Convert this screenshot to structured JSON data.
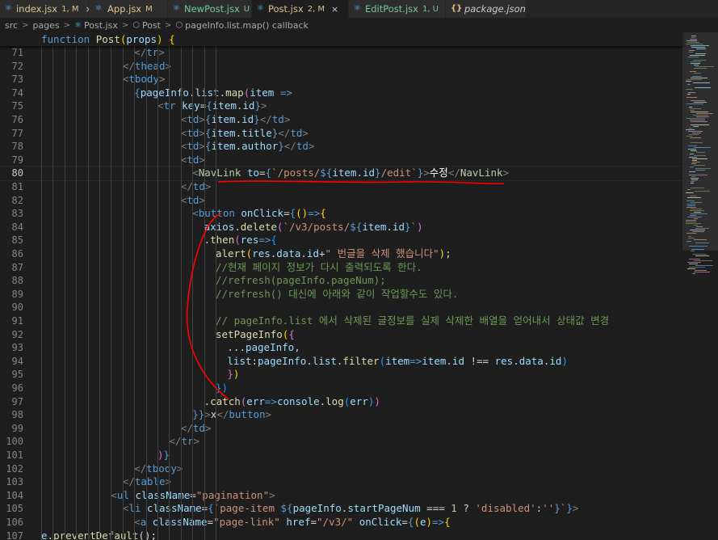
{
  "tabs": [
    {
      "name": "index.jsx",
      "badge": "1, M",
      "state": "mod",
      "icon": "react-icon",
      "close": "×"
    },
    {
      "name": "App.jsx",
      "badge": "M",
      "state": "mod",
      "icon": "react-icon"
    },
    {
      "name": "NewPost.jsx",
      "badge": "U",
      "state": "unt",
      "icon": "react-icon"
    },
    {
      "name": "Post.jsx",
      "badge": "2, M",
      "state": "mod",
      "icon": "react-icon",
      "close": "×"
    },
    {
      "name": "EditPost.jsx",
      "badge": "1, U",
      "state": "unt",
      "icon": "react-icon"
    },
    {
      "name": "package.json",
      "badge": "",
      "state": "plain",
      "icon": "json-icon"
    }
  ],
  "breadcrumb": {
    "parts": [
      "src",
      "pages",
      "Post.jsx",
      "Post",
      "pageInfo.list.map() callback"
    ],
    "separator": ">"
  },
  "sticky": {
    "text": "function Post(props) {"
  },
  "colors": {
    "background": "#1e1e1e",
    "keyword": "#569cd6",
    "string": "#ce9178",
    "variable": "#9cdcfe",
    "comment": "#6a9955",
    "annotation": "#ff0000"
  },
  "lines": [
    {
      "num": "71",
      "tokens": [
        [
          "</",
          "g"
        ],
        [
          "tr",
          "t"
        ],
        [
          ">",
          "g"
        ]
      ]
    },
    {
      "num": "72",
      "tokens": [
        [
          "</",
          "g"
        ],
        [
          "thead",
          "t"
        ],
        [
          ">",
          "g"
        ]
      ]
    },
    {
      "num": "73",
      "tokens": [
        [
          "<",
          "g"
        ],
        [
          "tbody",
          "t"
        ],
        [
          ">",
          "g"
        ]
      ]
    },
    {
      "num": "74",
      "tokens": [
        [
          "{",
          "k"
        ],
        [
          "pageInfo",
          "v"
        ],
        [
          ".",
          "w"
        ],
        [
          "list",
          "v"
        ],
        [
          ".",
          "w"
        ],
        [
          "map",
          "f"
        ],
        [
          "(",
          "p"
        ],
        [
          "item",
          "v"
        ],
        [
          " =>",
          "k"
        ]
      ]
    },
    {
      "num": "75",
      "tokens": [
        [
          "<",
          "g"
        ],
        [
          "tr",
          "t"
        ],
        [
          " ",
          "w"
        ],
        [
          "key",
          "v"
        ],
        [
          "=",
          "w"
        ],
        [
          "{",
          "k"
        ],
        [
          "item",
          "v"
        ],
        [
          ".",
          "w"
        ],
        [
          "id",
          "v"
        ],
        [
          "}",
          "k"
        ],
        [
          ">",
          "g"
        ]
      ]
    },
    {
      "num": "76",
      "tokens": [
        [
          "<",
          "g"
        ],
        [
          "td",
          "t"
        ],
        [
          ">",
          "g"
        ],
        [
          "{",
          "k"
        ],
        [
          "item",
          "v"
        ],
        [
          ".",
          "w"
        ],
        [
          "id",
          "v"
        ],
        [
          "}",
          "k"
        ],
        [
          "</",
          "g"
        ],
        [
          "td",
          "t"
        ],
        [
          ">",
          "g"
        ]
      ]
    },
    {
      "num": "77",
      "tokens": [
        [
          "<",
          "g"
        ],
        [
          "td",
          "t"
        ],
        [
          ">",
          "g"
        ],
        [
          "{",
          "k"
        ],
        [
          "item",
          "v"
        ],
        [
          ".",
          "w"
        ],
        [
          "title",
          "v"
        ],
        [
          "}",
          "k"
        ],
        [
          "</",
          "g"
        ],
        [
          "td",
          "t"
        ],
        [
          ">",
          "g"
        ]
      ]
    },
    {
      "num": "78",
      "tokens": [
        [
          "<",
          "g"
        ],
        [
          "td",
          "t"
        ],
        [
          ">",
          "g"
        ],
        [
          "{",
          "k"
        ],
        [
          "item",
          "v"
        ],
        [
          ".",
          "w"
        ],
        [
          "author",
          "v"
        ],
        [
          "}",
          "k"
        ],
        [
          "</",
          "g"
        ],
        [
          "td",
          "t"
        ],
        [
          ">",
          "g"
        ]
      ]
    },
    {
      "num": "79",
      "tokens": [
        [
          "<",
          "g"
        ],
        [
          "td",
          "t"
        ],
        [
          ">",
          "g"
        ]
      ]
    },
    {
      "num": "80",
      "tokens": [
        [
          "<",
          "g"
        ],
        [
          "NavLink",
          "n"
        ],
        [
          " ",
          "w"
        ],
        [
          "to",
          "v"
        ],
        [
          "=",
          "w"
        ],
        [
          "{",
          "k"
        ],
        [
          "`/posts/",
          "s"
        ],
        [
          "${",
          "k"
        ],
        [
          "item",
          "v"
        ],
        [
          ".",
          "w"
        ],
        [
          "id",
          "v"
        ],
        [
          "}",
          "k"
        ],
        [
          "/edit`",
          "s"
        ],
        [
          "}",
          "k"
        ],
        [
          ">",
          "g"
        ],
        [
          "수정",
          "ko"
        ],
        [
          "</",
          "g"
        ],
        [
          "NavLink",
          "n"
        ],
        [
          ">",
          "g"
        ]
      ]
    },
    {
      "num": "81",
      "tokens": [
        [
          "</",
          "g"
        ],
        [
          "td",
          "t"
        ],
        [
          ">",
          "g"
        ]
      ]
    },
    {
      "num": "82",
      "tokens": [
        [
          "<",
          "g"
        ],
        [
          "td",
          "t"
        ],
        [
          ">",
          "g"
        ]
      ]
    },
    {
      "num": "83",
      "tokens": [
        [
          "<",
          "g"
        ],
        [
          "button",
          "t"
        ],
        [
          " ",
          "w"
        ],
        [
          "onClick",
          "v"
        ],
        [
          "=",
          "w"
        ],
        [
          "{",
          "k"
        ],
        [
          "()",
          "y"
        ],
        [
          "=>",
          "k"
        ],
        [
          "{",
          "y"
        ]
      ]
    },
    {
      "num": "84",
      "tokens": [
        [
          "axios",
          "v"
        ],
        [
          ".",
          "w"
        ],
        [
          "delete",
          "f"
        ],
        [
          "(",
          "p"
        ],
        [
          "`/v3/posts/",
          "s"
        ],
        [
          "${",
          "k"
        ],
        [
          "item",
          "v"
        ],
        [
          ".",
          "w"
        ],
        [
          "id",
          "v"
        ],
        [
          "}",
          "k"
        ],
        [
          "`",
          "s"
        ],
        [
          ")",
          "p"
        ]
      ]
    },
    {
      "num": "85",
      "tokens": [
        [
          ".",
          "w"
        ],
        [
          "then",
          "f"
        ],
        [
          "(",
          "p"
        ],
        [
          "res",
          "v"
        ],
        [
          "=>",
          "k"
        ],
        [
          "{",
          "b"
        ]
      ]
    },
    {
      "num": "86",
      "tokens": [
        [
          "alert",
          "f"
        ],
        [
          "(",
          "y"
        ],
        [
          "res",
          "v"
        ],
        [
          ".",
          "w"
        ],
        [
          "data",
          "v"
        ],
        [
          ".",
          "w"
        ],
        [
          "id",
          "v"
        ],
        [
          "+",
          "w"
        ],
        [
          "\" 번글을 삭제 했습니다\"",
          "s"
        ],
        [
          ")",
          "y"
        ],
        [
          ";",
          "w"
        ]
      ]
    },
    {
      "num": "87",
      "tokens": [
        [
          "//현재 페이지 정보가 다시 출력되도록 한다.",
          "cm"
        ]
      ]
    },
    {
      "num": "88",
      "tokens": [
        [
          "//refresh(pageInfo.pageNum);",
          "cm"
        ]
      ]
    },
    {
      "num": "89",
      "tokens": [
        [
          "//refresh() 대신에 아래와 같이 작업할수도 있다.",
          "cm"
        ]
      ]
    },
    {
      "num": "90",
      "tokens": []
    },
    {
      "num": "91",
      "tokens": [
        [
          "// pageInfo.list 에서 삭제된 글정보를 실제 삭제한 배열을 얻어내서 상태값 변경",
          "cm"
        ]
      ]
    },
    {
      "num": "92",
      "tokens": [
        [
          "setPageInfo",
          "f"
        ],
        [
          "(",
          "y"
        ],
        [
          "{",
          "p"
        ]
      ]
    },
    {
      "num": "93",
      "tokens": [
        [
          "...",
          "w"
        ],
        [
          "pageInfo",
          "v"
        ],
        [
          ",",
          "w"
        ]
      ]
    },
    {
      "num": "94",
      "tokens": [
        [
          "list",
          "v"
        ],
        [
          ":",
          "w"
        ],
        [
          "pageInfo",
          "v"
        ],
        [
          ".",
          "w"
        ],
        [
          "list",
          "v"
        ],
        [
          ".",
          "w"
        ],
        [
          "filter",
          "f"
        ],
        [
          "(",
          "b"
        ],
        [
          "item",
          "v"
        ],
        [
          "=>",
          "k"
        ],
        [
          "item",
          "v"
        ],
        [
          ".",
          "w"
        ],
        [
          "id",
          "v"
        ],
        [
          " !== ",
          "w"
        ],
        [
          "res",
          "v"
        ],
        [
          ".",
          "w"
        ],
        [
          "data",
          "v"
        ],
        [
          ".",
          "w"
        ],
        [
          "id",
          "v"
        ],
        [
          ")",
          "b"
        ]
      ]
    },
    {
      "num": "95",
      "tokens": [
        [
          "}",
          "p"
        ],
        [
          ")",
          "y"
        ]
      ]
    },
    {
      "num": "96",
      "tokens": [
        [
          "})",
          "b"
        ]
      ]
    },
    {
      "num": "97",
      "tokens": [
        [
          ".",
          "w"
        ],
        [
          "catch",
          "f"
        ],
        [
          "(",
          "p"
        ],
        [
          "err",
          "v"
        ],
        [
          "=>",
          "k"
        ],
        [
          "console",
          "v"
        ],
        [
          ".",
          "w"
        ],
        [
          "log",
          "f"
        ],
        [
          "(",
          "b"
        ],
        [
          "err",
          "v"
        ],
        [
          ")",
          "b"
        ],
        [
          ")",
          "p"
        ]
      ]
    },
    {
      "num": "98",
      "tokens": [
        [
          "}}",
          "k"
        ],
        [
          ">",
          "g"
        ],
        [
          "x",
          "w"
        ],
        [
          "</",
          "g"
        ],
        [
          "button",
          "t"
        ],
        [
          ">",
          "g"
        ]
      ]
    },
    {
      "num": "99",
      "tokens": [
        [
          "</",
          "g"
        ],
        [
          "td",
          "t"
        ],
        [
          ">",
          "g"
        ]
      ]
    },
    {
      "num": "100",
      "tokens": [
        [
          "</",
          "g"
        ],
        [
          "tr",
          "t"
        ],
        [
          ">",
          "g"
        ]
      ]
    },
    {
      "num": "101",
      "tokens": [
        [
          ")",
          "p"
        ],
        [
          "}",
          "k"
        ]
      ]
    },
    {
      "num": "102",
      "tokens": [
        [
          "</",
          "g"
        ],
        [
          "tbody",
          "t"
        ],
        [
          ">",
          "g"
        ]
      ]
    },
    {
      "num": "103",
      "tokens": [
        [
          "</",
          "g"
        ],
        [
          "table",
          "t"
        ],
        [
          ">",
          "g"
        ]
      ]
    },
    {
      "num": "104",
      "tokens": [
        [
          "<",
          "g"
        ],
        [
          "ul",
          "t"
        ],
        [
          " ",
          "w"
        ],
        [
          "className",
          "v"
        ],
        [
          "=",
          "w"
        ],
        [
          "\"pagination\"",
          "s"
        ],
        [
          ">",
          "g"
        ]
      ]
    },
    {
      "num": "105",
      "tokens": [
        [
          "<",
          "g"
        ],
        [
          "li",
          "t"
        ],
        [
          " ",
          "w"
        ],
        [
          "className",
          "v"
        ],
        [
          "=",
          "w"
        ],
        [
          "{",
          "k"
        ],
        [
          "`page-item ",
          "s"
        ],
        [
          "${",
          "k"
        ],
        [
          "pageInfo",
          "v"
        ],
        [
          ".",
          "w"
        ],
        [
          "startPageNum",
          "v"
        ],
        [
          " === ",
          "w"
        ],
        [
          "1",
          "n"
        ],
        [
          " ? ",
          "w"
        ],
        [
          "'disabled'",
          "s"
        ],
        [
          ":",
          "w"
        ],
        [
          "''",
          "s"
        ],
        [
          "}",
          "k"
        ],
        [
          "`",
          "s"
        ],
        [
          "}",
          "k"
        ],
        [
          ">",
          "g"
        ]
      ]
    },
    {
      "num": "106",
      "tokens": [
        [
          "<",
          "g"
        ],
        [
          "a",
          "t"
        ],
        [
          " ",
          "w"
        ],
        [
          "className",
          "v"
        ],
        [
          "=",
          "w"
        ],
        [
          "\"page-link\"",
          "s"
        ],
        [
          " ",
          "w"
        ],
        [
          "href",
          "v"
        ],
        [
          "=",
          "w"
        ],
        [
          "\"/v3/\"",
          "s"
        ],
        [
          " ",
          "w"
        ],
        [
          "onClick",
          "v"
        ],
        [
          "=",
          "w"
        ],
        [
          "{",
          "k"
        ],
        [
          "(",
          "y"
        ],
        [
          "e",
          "v"
        ],
        [
          ")",
          "y"
        ],
        [
          "=>",
          "k"
        ],
        [
          "{",
          "y"
        ]
      ]
    },
    {
      "num": "107",
      "tokens": [
        [
          "e",
          "v"
        ],
        [
          ".",
          "w"
        ],
        [
          "preventDefault",
          "f"
        ],
        [
          "();",
          "w"
        ]
      ]
    }
  ]
}
